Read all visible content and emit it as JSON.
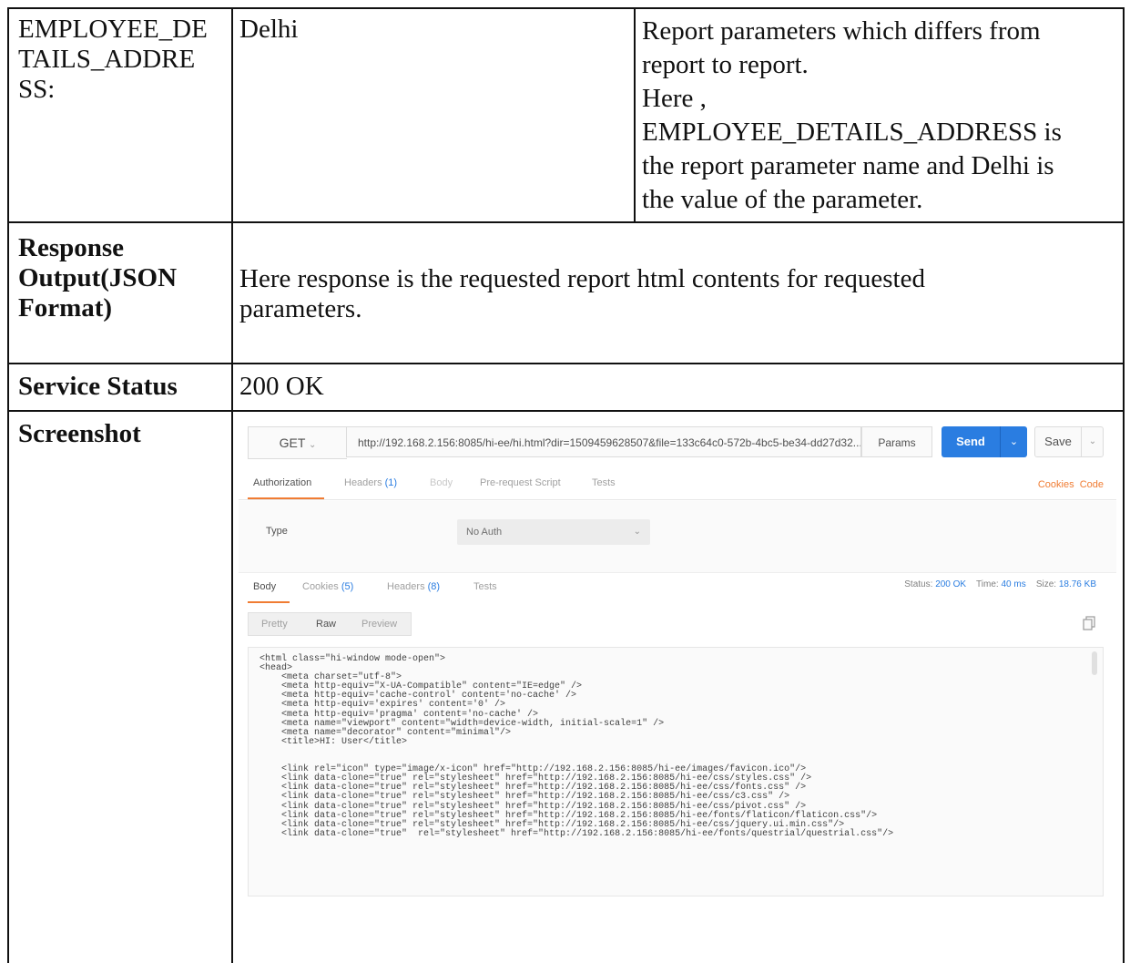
{
  "document": {
    "row1": {
      "label": "EMPLOYEE_DE\nTAILS_ADDRE\nSS:",
      "value": "Delhi",
      "description": "Report parameters which differs from\nreport to report.\nHere ,\nEMPLOYEE_DETAILS_ADDRESS is\nthe report parameter name and Delhi is\nthe value of the parameter."
    },
    "row2": {
      "label": "Response\nOutput(JSON\nFormat)",
      "value": "Here response is the requested report html contents for requested\nparameters."
    },
    "row3": {
      "label": "Service Status",
      "value": "200 OK"
    },
    "row4": {
      "label": "Screenshot"
    }
  },
  "screenshot": {
    "method": "GET",
    "url": "http://192.168.2.156:8085/hi-ee/hi.html?dir=1509459628507&file=133c64c0-572b-4bc5-be34-dd27d32...",
    "params_label": "Params",
    "send_label": "Send",
    "save_label": "Save",
    "request_tabs": {
      "authorization": "Authorization",
      "headers": "Headers",
      "headers_count": "(1)",
      "body": "Body",
      "prerequest": "Pre-request Script",
      "tests": "Tests"
    },
    "cookies_link": "Cookies",
    "code_link": "Code",
    "auth": {
      "type_label": "Type",
      "type_value": "No Auth"
    },
    "response_tabs": {
      "body": "Body",
      "cookies": "Cookies",
      "cookies_count": "(5)",
      "headers": "Headers",
      "headers_count": "(8)",
      "tests": "Tests"
    },
    "status": {
      "status_label": "Status:",
      "status_value": "200 OK",
      "time_label": "Time:",
      "time_value": "40 ms",
      "size_label": "Size:",
      "size_value": "18.76 KB"
    },
    "format_tabs": {
      "pretty": "Pretty",
      "raw": "Raw",
      "preview": "Preview"
    },
    "response_code": "<html class=\"hi-window mode-open\">\n<head>\n    <meta charset=\"utf-8\">\n    <meta http-equiv=\"X-UA-Compatible\" content=\"IE=edge\" />\n    <meta http-equiv='cache-control' content='no-cache' />\n    <meta http-equiv='expires' content='0' />\n    <meta http-equiv='pragma' content='no-cache' />\n    <meta name=\"viewport\" content=\"width=device-width, initial-scale=1\" />\n    <meta name=\"decorator\" content=\"minimal\"/>\n    <title>HI: User</title>\n\n\n    <link rel=\"icon\" type=\"image/x-icon\" href=\"http://192.168.2.156:8085/hi-ee/images/favicon.ico\"/>\n    <link data-clone=\"true\" rel=\"stylesheet\" href=\"http://192.168.2.156:8085/hi-ee/css/styles.css\" />\n    <link data-clone=\"true\" rel=\"stylesheet\" href=\"http://192.168.2.156:8085/hi-ee/css/fonts.css\" />\n    <link data-clone=\"true\" rel=\"stylesheet\" href=\"http://192.168.2.156:8085/hi-ee/css/c3.css\" />\n    <link data-clone=\"true\" rel=\"stylesheet\" href=\"http://192.168.2.156:8085/hi-ee/css/pivot.css\" />\n    <link data-clone=\"true\" rel=\"stylesheet\" href=\"http://192.168.2.156:8085/hi-ee/fonts/flaticon/flaticon.css\"/>\n    <link data-clone=\"true\" rel=\"stylesheet\" href=\"http://192.168.2.156:8085/hi-ee/css/jquery.ui.min.css\"/>\n    <link data-clone=\"true\"  rel=\"stylesheet\" href=\"http://192.168.2.156:8085/hi-ee/fonts/questrial/questrial.css\"/>"
  }
}
